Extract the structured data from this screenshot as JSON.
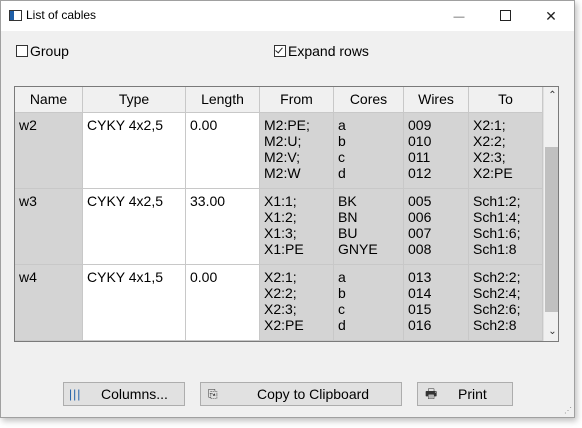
{
  "window": {
    "title": "List of cables",
    "minimize_glyph": "—",
    "close_glyph": "✕"
  },
  "options": {
    "group_label": "Group",
    "group_checked": false,
    "expand_label": "Expand rows",
    "expand_checked": true
  },
  "table": {
    "headers": [
      "Name",
      "Type",
      "Length",
      "From",
      "Cores",
      "Wires",
      "To"
    ],
    "rows": [
      {
        "name": "w2",
        "type": "CYKY 4x2,5",
        "length": "0.00",
        "from": "M2:PE;\nM2:U;\nM2:V;\nM2:W",
        "cores": "a\nb\nc\nd",
        "wires": "009\n010\n011\n012",
        "to": "X2:1;\nX2:2;\nX2:3;\nX2:PE"
      },
      {
        "name": "w3",
        "type": "CYKY 4x2,5",
        "length": "33.00",
        "from": "X1:1;\nX1:2;\nX1:3;\nX1:PE",
        "cores": "BK\nBN\nBU\nGNYE",
        "wires": "005\n006\n007\n008",
        "to": "Sch1:2;\nSch1:4;\nSch1:6;\nSch1:8"
      },
      {
        "name": "w4",
        "type": "CYKY 4x1,5",
        "length": "0.00",
        "from": "X2:1;\nX2:2;\nX2:3;\nX2:PE",
        "cores": "a\nb\nc\nd",
        "wires": "013\n014\n015\n016",
        "to": "Sch2:2;\nSch2:4;\nSch2:6;\nSch2:8"
      }
    ]
  },
  "buttons": {
    "columns": {
      "label": "Columns...",
      "icon": "columns-icon",
      "glyph": "|||"
    },
    "copy": {
      "label": "Copy to Clipboard",
      "icon": "clipboard-icon",
      "glyph": "⎘"
    },
    "print": {
      "label": "Print",
      "icon": "printer-icon",
      "glyph": "🖶"
    }
  },
  "scrollbar": {
    "up_glyph": "⌃",
    "down_glyph": "⌄"
  },
  "colors": {
    "grey_cell": "#d4d4d4",
    "window_bg": "#f0f0f0",
    "accent": "#1e5fa8"
  }
}
